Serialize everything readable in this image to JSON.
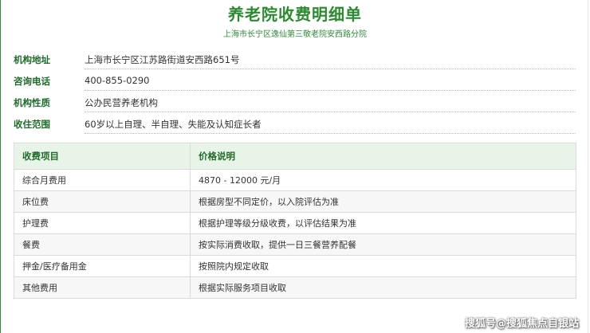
{
  "header": {
    "title": "养老院收费明细单",
    "subtitle": "上海市长宁区逸仙第三敬老院安西路分院"
  },
  "info": [
    {
      "label": "机构地址",
      "value": "上海市长宁区江苏路街道安西路651号"
    },
    {
      "label": "咨询电话",
      "value": "400-855-0290"
    },
    {
      "label": "机构性质",
      "value": "公办民营养老机构"
    },
    {
      "label": "收住范围",
      "value": "60岁以上自理、半自理、失能及认知症长者"
    }
  ],
  "table": {
    "headers": [
      "收费项目",
      "价格说明"
    ],
    "rows": [
      [
        "综合月费用",
        "4870 - 12000 元/月"
      ],
      [
        "床位费",
        "根据房型不同定价，以入院评估为准"
      ],
      [
        "护理费",
        "根据护理等级分级收费，以评估结果为准"
      ],
      [
        "餐费",
        "按实际消费收取，提供一日三餐营养配餐"
      ],
      [
        "押金/医疗备用金",
        "按照院内规定收取"
      ],
      [
        "其他费用",
        "根据实际服务项目收取"
      ]
    ]
  },
  "watermark": "搜狐号@搜狐焦点自银站",
  "colors": {
    "accent": "#2a8a2f",
    "header_bg": "#e9f4e8",
    "label": "#1f6b2a"
  }
}
